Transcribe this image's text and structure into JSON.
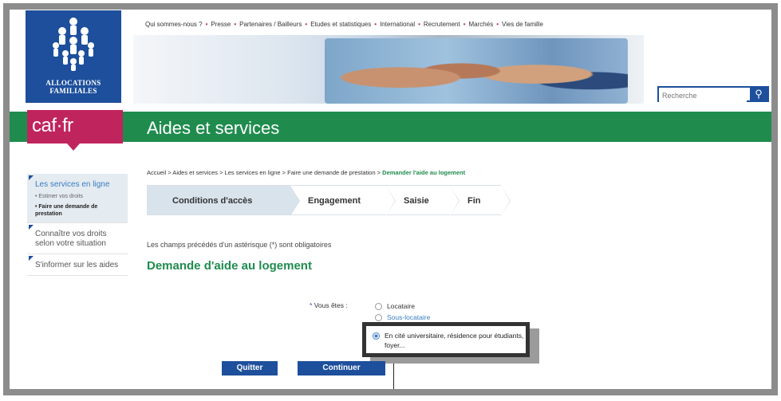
{
  "logo": {
    "name_line1": "ALLOCATIONS",
    "name_line2": "FAMILIALES"
  },
  "topnav": {
    "items": [
      "Qui sommes-nous ?",
      "Presse",
      "Partenaires / Bailleurs",
      "Etudes et statistiques",
      "International",
      "Recrutement",
      "Marchés",
      "Vies de famille"
    ],
    "separator": "•"
  },
  "search": {
    "placeholder": "Recherche",
    "icon": "search-icon"
  },
  "brand": {
    "caf": "caf·fr"
  },
  "page_title": "Aides et services",
  "sidebar": {
    "groups": [
      {
        "label": "Les services en ligne",
        "active": true,
        "subs": [
          "• Estimer vos droits",
          "• Faire une demande de prestation"
        ]
      },
      {
        "label": "Connaître vos droits selon votre situation",
        "active": false,
        "subs": []
      },
      {
        "label": "S'informer sur les aides",
        "active": false,
        "subs": []
      }
    ]
  },
  "breadcrumb": {
    "path": "Accueil > Aides et services > Les services en ligne > Faire une demande de prestation > ",
    "current": "Demander l'aide au logement"
  },
  "steps": [
    "Conditions d'accès",
    "Engagement",
    "Saisie",
    "Fin"
  ],
  "form": {
    "mandatory_note": "Les champs précédés d'un astérisque (*) sont obligatoires",
    "title": "Demande d'aide au logement",
    "question_star": "*",
    "question": "Vous êtes :",
    "options": [
      "Locataire",
      "Sous-locataire"
    ],
    "highlight_option": "En cité universitaire, résidence pour étudiants, foyer...",
    "quit_label": "Quitter",
    "continue_label": "Continuer"
  },
  "colors": {
    "blue": "#1d4f9c",
    "green": "#1f8c4e",
    "magenta": "#c0245c"
  }
}
